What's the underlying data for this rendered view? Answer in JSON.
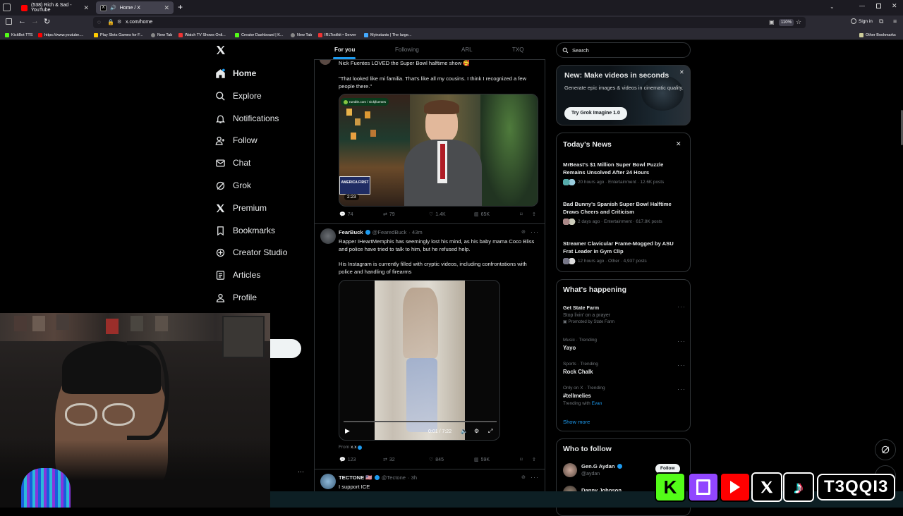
{
  "browser": {
    "tabs": [
      {
        "title": "(538) Rich & Sad - YouTube",
        "active": false
      },
      {
        "title": "Home / X",
        "active": true
      }
    ],
    "url": "x.com/home",
    "zoom": "110%",
    "sign_in": "Sign in",
    "bookmarks": [
      "KickBot TTS",
      "https://www.youtube....",
      "Play Slots Games for F...",
      "New Tab",
      "Watch TV Shows Onli...",
      "Creator Dashboard | K...",
      "New Tab",
      "IRLToolkit • Server",
      "Myinstants | The large..."
    ],
    "other_bookmarks": "Other Bookmarks"
  },
  "sidebar": {
    "items": [
      {
        "label": "Home",
        "icon": "home-icon"
      },
      {
        "label": "Explore",
        "icon": "search-icon"
      },
      {
        "label": "Notifications",
        "icon": "bell-icon"
      },
      {
        "label": "Follow",
        "icon": "follow-icon"
      },
      {
        "label": "Chat",
        "icon": "mail-icon"
      },
      {
        "label": "Grok",
        "icon": "grok-icon"
      },
      {
        "label": "Premium",
        "icon": "x-logo-icon"
      },
      {
        "label": "Bookmarks",
        "icon": "bookmark-icon"
      },
      {
        "label": "Creator Studio",
        "icon": "creator-studio-icon"
      },
      {
        "label": "Articles",
        "icon": "articles-icon"
      },
      {
        "label": "Profile",
        "icon": "profile-icon"
      }
    ],
    "more": "···"
  },
  "feed": {
    "tabs": [
      "For you",
      "Following",
      "ARL",
      "TXQ"
    ],
    "post1": {
      "text1": "Nick Fuentes LOVED the Super Bowl halftime show 🥰",
      "quote": "\"That looked like mi familia. That's like all my cousins. I think I recognized a few people there.\"",
      "source_tag": "rumble.com / nickjfuentes",
      "video_duration": "2:23",
      "sign": "AMERICA FIRST",
      "replies": "74",
      "reposts": "79",
      "likes": "1.4K",
      "views": "65K"
    },
    "post2": {
      "name": "FearBuck",
      "handle": "@FearedBuck",
      "time": "· 43m",
      "text1": "Rapper IHeartMemphis has seemingly lost his mind, as his baby mama Coco Bliss and police have tried to talk to him, but he refused help.",
      "text2": "His Instagram is currently filled with cryptic videos, including confrontations with police and handling of firearms",
      "video_time": "0:01 / 7:22",
      "from_label": "From",
      "from_name": "x.x",
      "replies": "123",
      "reposts": "32",
      "likes": "845",
      "views": "59K"
    },
    "post3": {
      "name": "TECTONE 🇺🇸",
      "handle": "@Tectone",
      "time": "· 3h",
      "text": "I support ICE"
    }
  },
  "right": {
    "search_placeholder": "Search",
    "promo": {
      "title": "New: Make videos in seconds",
      "body": "Generate epic images & videos in cinematic quality.",
      "button": "Try Grok Imagine 1.0"
    },
    "news": {
      "title": "Today's News",
      "items": [
        {
          "headline": "MrBeast's $1 Million Super Bowl Puzzle Remains Unsolved After 24 Hours",
          "meta": "20 hours ago · Entertainment · 12.6K posts"
        },
        {
          "headline": "Bad Bunny's Spanish Super Bowl Halftime Draws Cheers and Criticism",
          "meta": "2 days ago · Entertainment · 617.8K posts"
        },
        {
          "headline": "Streamer Clavicular Frame-Mogged by ASU Frat Leader in Gym Clip",
          "meta": "12 hours ago · Other · 4,937 posts"
        }
      ]
    },
    "happening": {
      "title": "What's happening",
      "items": [
        {
          "top": "Get State Farm",
          "mid": "Stop livin' on a prayer",
          "bottom": "Promoted by State Farm"
        },
        {
          "top": "Music · Trending",
          "mid": "Yayo"
        },
        {
          "top": "Sports · Trending",
          "mid": "Rock Chalk"
        },
        {
          "top": "Only on X · Trending",
          "mid": "#tellmelies",
          "bottom_prefix": "Trending with",
          "bottom_link": "Evan"
        }
      ],
      "show_more": "Show more"
    },
    "follow": {
      "title": "Who to follow",
      "items": [
        {
          "name": "Gen.G Aydan",
          "handle": "@aydan"
        },
        {
          "name": "Danny Johnson",
          "handle": ""
        }
      ],
      "follow_btn": "Follow"
    }
  },
  "overlay": {
    "brand": "T3QQI3",
    "colors": {
      "kick": "#53fc18",
      "twitch": "#9146ff",
      "youtube": "#ff0000",
      "x": "#000000",
      "tiktok": "#000000"
    }
  },
  "colors": {
    "accent": "#1d9bf0",
    "bg": "#000000",
    "border": "#2f3336",
    "muted": "#71767b"
  }
}
